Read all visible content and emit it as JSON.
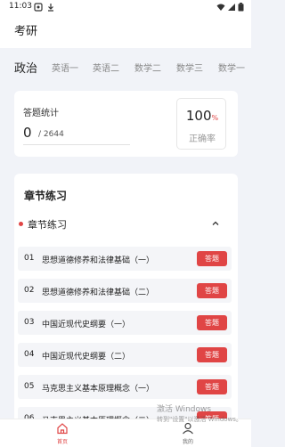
{
  "status_bar": {
    "time": "11:03",
    "icons": [
      "notification-icon",
      "download-icon",
      "wifi-icon",
      "signal-icon",
      "battery-icon"
    ]
  },
  "header": {
    "title": "考研"
  },
  "subjects": {
    "tabs": [
      {
        "label": "政治",
        "active": true
      },
      {
        "label": "英语一",
        "active": false
      },
      {
        "label": "英语二",
        "active": false
      },
      {
        "label": "数学二",
        "active": false
      },
      {
        "label": "数学三",
        "active": false
      },
      {
        "label": "数学一",
        "active": false
      }
    ]
  },
  "stats": {
    "title": "答题统计",
    "answered": "0",
    "total": "/ 2644",
    "accuracy_value": "100",
    "accuracy_unit": "%",
    "accuracy_label": "正确率"
  },
  "chapters": {
    "heading": "章节练习",
    "group_title": "章节练习",
    "answer_label": "答题",
    "items": [
      {
        "num": "01",
        "name": "思想道德修养和法律基础（一）"
      },
      {
        "num": "02",
        "name": "思想道德修养和法律基础（二）"
      },
      {
        "num": "03",
        "name": "中国近现代史纲要（一）"
      },
      {
        "num": "04",
        "name": "中国近现代史纲要（二）"
      },
      {
        "num": "05",
        "name": "马克思主义基本原理概念（一）"
      },
      {
        "num": "06",
        "name": "马克思主义基本原理概念（二）"
      }
    ]
  },
  "watermark": {
    "line1": "激活 Windows",
    "line2": "转到\"设置\"以激活 Windows。"
  },
  "bottom_nav": {
    "items": [
      {
        "label": "首页",
        "icon": "home-icon",
        "active": true
      },
      {
        "label": "我的",
        "icon": "profile-icon",
        "active": false
      }
    ]
  },
  "colors": {
    "accent": "#e04545",
    "background": "#f1f3f8",
    "card": "#ffffff",
    "row": "#f4f5f8"
  }
}
